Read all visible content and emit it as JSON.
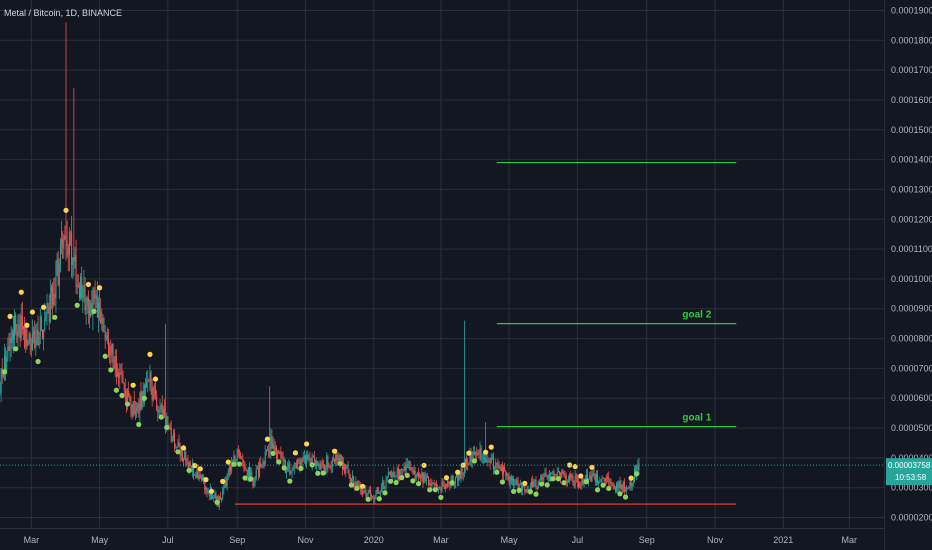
{
  "header": {
    "title": "Metal / Bitcoin, 1D, BINANCE"
  },
  "price_badge": {
    "value": "0.00003758",
    "countdown": "10:53:58"
  },
  "colors": {
    "background": "#131722",
    "grid": "#2a2e39",
    "up": "#26a69a",
    "down": "#ef5350",
    "goal_line": "#2ecc40",
    "support_line": "#e53935",
    "price_line": "#26a69a",
    "badge": "#26a69a",
    "marker_buy": "#8bd35a",
    "marker_sell": "#ffd54f",
    "marker_red": "#e15759"
  },
  "chart_data": {
    "type": "candlestick",
    "title": "Metal / Bitcoin, 1D, BINANCE",
    "y_axis": {
      "position": "right",
      "ticks": [
        "0.00002000",
        "0.00003000",
        "0.00004000",
        "0.00005000",
        "0.00006000",
        "0.00007000",
        "0.00008000",
        "0.00009000",
        "0.00010000",
        "0.00011000",
        "0.00012000",
        "0.00013000",
        "0.00014000",
        "0.00015000",
        "0.00016000",
        "0.00017000",
        "0.00018000",
        "0.00019000"
      ],
      "range": [
        1.65e-05,
        0.0001935
      ]
    },
    "x_axis": {
      "ticks": [
        "Mar",
        "May",
        "Jul",
        "Sep",
        "Nov",
        "2020",
        "Mar",
        "May",
        "Jul",
        "Sep",
        "Nov",
        "2021",
        "Mar"
      ],
      "start": "2019-02-01",
      "end": "2021-04-01"
    },
    "grid": true,
    "current_price": 3.758e-05,
    "anchors": [
      [
        "2019-02-01",
        6.5e-05
      ],
      [
        "2019-02-15",
        8.6e-05
      ],
      [
        "2019-03-01",
        7.8e-05
      ],
      [
        "2019-03-15",
        8.7e-05
      ],
      [
        "2019-04-01",
        0.000115
      ],
      [
        "2019-04-15",
        9.5e-05
      ],
      [
        "2019-05-01",
        9e-05
      ],
      [
        "2019-05-15",
        7e-05
      ],
      [
        "2019-06-01",
        5.5e-05
      ],
      [
        "2019-06-15",
        6.5e-05
      ],
      [
        "2019-07-01",
        5e-05
      ],
      [
        "2019-07-15",
        4e-05
      ],
      [
        "2019-08-01",
        3.2e-05
      ],
      [
        "2019-08-15",
        2.5e-05
      ],
      [
        "2019-09-01",
        4.2e-05
      ],
      [
        "2019-09-15",
        3.2e-05
      ],
      [
        "2019-10-01",
        4.5e-05
      ],
      [
        "2019-10-15",
        3.6e-05
      ],
      [
        "2019-11-01",
        3.9e-05
      ],
      [
        "2019-11-15",
        3.8e-05
      ],
      [
        "2019-12-01",
        4e-05
      ],
      [
        "2019-12-15",
        3.1e-05
      ],
      [
        "2020-01-01",
        2.7e-05
      ],
      [
        "2020-01-15",
        3.4e-05
      ],
      [
        "2020-02-01",
        3.6e-05
      ],
      [
        "2020-02-15",
        3.3e-05
      ],
      [
        "2020-03-01",
        3e-05
      ],
      [
        "2020-03-15",
        3.3e-05
      ],
      [
        "2020-04-01",
        4.3e-05
      ],
      [
        "2020-04-15",
        3.9e-05
      ],
      [
        "2020-05-01",
        3.3e-05
      ],
      [
        "2020-05-15",
        2.9e-05
      ],
      [
        "2020-06-01",
        3.3e-05
      ],
      [
        "2020-06-15",
        3.4e-05
      ],
      [
        "2020-07-01",
        3.2e-05
      ],
      [
        "2020-07-15",
        3.4e-05
      ],
      [
        "2020-08-01",
        3.1e-05
      ],
      [
        "2020-08-15",
        3e-05
      ],
      [
        "2020-08-25",
        3.76e-05
      ]
    ],
    "spikes": [
      [
        "2019-04-01",
        0.000186
      ],
      [
        "2019-04-08",
        0.000164
      ],
      [
        "2019-06-29",
        8.5e-05
      ],
      [
        "2019-09-30",
        6.4e-05
      ],
      [
        "2020-03-22",
        8.6e-05
      ],
      [
        "2020-04-10",
        5.2e-05
      ],
      [
        "2020-08-25",
        4e-05
      ]
    ],
    "lines": [
      {
        "label": "",
        "value": 0.000139,
        "from": "2020-04-20",
        "to": "2020-11-20",
        "color": "#2ecc40"
      },
      {
        "label": "goal 2",
        "value": 8.5e-05,
        "from": "2020-04-20",
        "to": "2020-11-20",
        "color": "#2ecc40"
      },
      {
        "label": "goal 1",
        "value": 5.05e-05,
        "from": "2020-04-20",
        "to": "2020-11-20",
        "color": "#2ecc40"
      },
      {
        "label": "",
        "value": 2.45e-05,
        "from": "2019-08-30",
        "to": "2020-11-20",
        "color": "#e53935"
      }
    ]
  }
}
